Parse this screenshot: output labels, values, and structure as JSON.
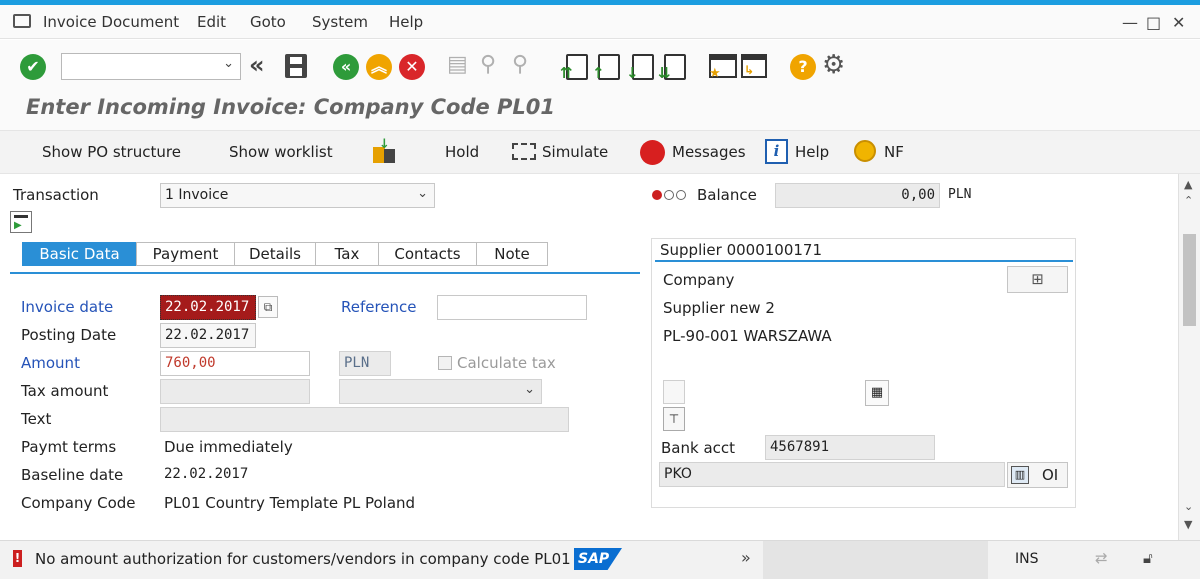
{
  "menubar": {
    "items": [
      "Invoice Document",
      "Edit",
      "Goto",
      "System",
      "Help"
    ],
    "window_controls": [
      "—",
      "□",
      "✕"
    ]
  },
  "toolbar": {
    "command_field_value": "",
    "icons": [
      "enter-icon",
      "save-icon",
      "back-icon",
      "exit-icon",
      "cancel-icon",
      "print-icon",
      "find-icon",
      "find-next-icon",
      "first-page-icon",
      "previous-page-icon",
      "next-page-icon",
      "last-page-icon",
      "create-session-icon",
      "shortcut-icon",
      "help-icon",
      "settings-icon"
    ]
  },
  "page": {
    "title": "Enter Incoming Invoice: Company Code PL01"
  },
  "app_toolbar": {
    "show_po_structure": "Show PO structure",
    "show_worklist": "Show worklist",
    "hold": "Hold",
    "simulate": "Simulate",
    "messages": "Messages",
    "help": "Help",
    "nf": "NF"
  },
  "header": {
    "transaction_label": "Transaction",
    "transaction_value": "1 Invoice",
    "balance_label": "Balance",
    "balance_value": "0,00",
    "balance_currency": "PLN",
    "status_color": "#cc1f1f"
  },
  "tabs": [
    "Basic Data",
    "Payment",
    "Details",
    "Tax",
    "Contacts",
    "Note"
  ],
  "basic_data": {
    "invoice_date_label": "Invoice date",
    "invoice_date_value": "22.02.2017",
    "reference_label": "Reference",
    "reference_value": "",
    "posting_date_label": "Posting Date",
    "posting_date_value": "22.02.2017",
    "amount_label": "Amount",
    "amount_value": "760,00",
    "currency_value": "PLN",
    "calculate_tax_label": "Calculate tax",
    "tax_amount_label": "Tax amount",
    "tax_amount_value": "",
    "tax_code_value": "",
    "text_label": "Text",
    "text_value": "",
    "paymt_terms_label": "Paymt terms",
    "paymt_terms_value": "Due immediately",
    "baseline_date_label": "Baseline date",
    "baseline_date_value": "22.02.2017",
    "company_code_label": "Company Code",
    "company_code_value": "PL01 Country Template PL Poland"
  },
  "supplier": {
    "heading": "Supplier 0000100171",
    "type": "Company",
    "name": "Supplier new 2",
    "address": "PL-90-001 WARSZAWA",
    "bank_acct_label": "Bank acct",
    "bank_acct_value": "4567891",
    "bank_name_value": "PKO",
    "oi_label": "OI"
  },
  "statusbar": {
    "message": "No amount authorization for customers/vendors in company code PL01",
    "logo": "SAP",
    "expand": "»",
    "mode": "INS",
    "accent_color": "#0a6ed1"
  }
}
